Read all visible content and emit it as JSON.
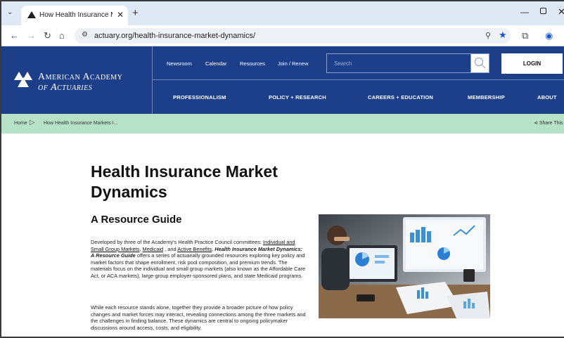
{
  "browser": {
    "tab_title": "How Health Insurance Markets",
    "tab_close": "✕",
    "new_tab": "+",
    "url": "actuary.org/health-insurance-market-dynamics/"
  },
  "site": {
    "logo_line1": "American Academy",
    "logo_line2": "of Actuaries",
    "utility_links": [
      "Newsroom",
      "Calendar",
      "Resources",
      "Join / Renew"
    ],
    "search_placeholder": "Search",
    "login": "LOGIN",
    "nav": [
      "PROFESSIONALISM",
      "POLICY + RESEARCH",
      "CAREERS + EDUCATION",
      "MEMBERSHIP",
      "ABOUT"
    ]
  },
  "breadcrumb": {
    "home": "Home",
    "current": "How Health Insurance Markets I...",
    "share": "Share This"
  },
  "content": {
    "title": "Health Insurance Market Dynamics",
    "subtitle": "A Resource Guide",
    "p1_intro": "Developed by three of the Academy's Health Practice Council committees:",
    "p1_link1": "Individual and Small Group Markets",
    "p1_link2": "Medicaid",
    "p1_link3": "Active Benefits",
    "p1_em": "Health Insurance Market Dynamics: A Resource Guide",
    "p1_rest": "offers a series of actuarially grounded resources exploring key policy and market factors that shape enrollment, risk pool composition, and premium trends. The materials focus on the individual and small group markets (also known as the Affordable Care Act, or ACA markets), large-group employer-sponsored plans, and state Medicaid programs.",
    "p2": "While each resource stands alone, together they provide a broader picture of how policy changes and market forces may interact, revealing connections among the three markets and the challenges in finding balance. These dynamics are central to ongoing policymaker discussions around access, costs, and eligibility."
  },
  "colors": {
    "header_blue": "#1d3f89",
    "breadcrumb_green": "#b6e3c8",
    "tabstrip": "#dfe8f5"
  }
}
